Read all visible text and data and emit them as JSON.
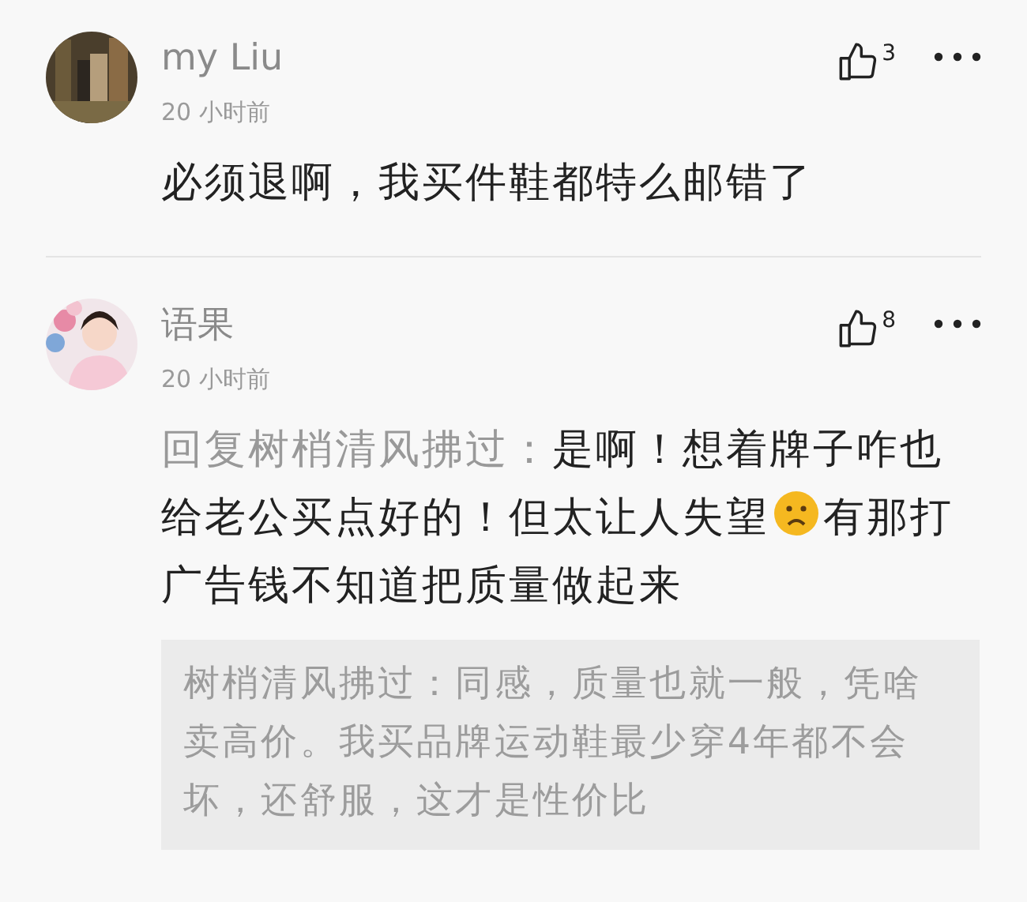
{
  "comments": [
    {
      "author": "my Liu",
      "time": "20 小时前",
      "likes": "3",
      "body_parts": [
        {
          "kind": "text",
          "text": "必须退啊，我买件鞋都特么邮错了"
        }
      ]
    },
    {
      "author": "语果",
      "time": "20 小时前",
      "likes": "8",
      "reply_to": "回复树梢清风拂过：",
      "body_parts": [
        {
          "kind": "text",
          "text": "是啊！想着牌子咋也给老公买点好的！但太让人失望"
        },
        {
          "kind": "emoji"
        },
        {
          "kind": "text",
          "text": "有那打广告钱不知道把质量做起来"
        }
      ],
      "quote": "树梢清风拂过：同感，质量也就一般，凭啥卖高价。我买品牌运动鞋最少穿4年都不会坏，还舒服，这才是性价比"
    }
  ]
}
